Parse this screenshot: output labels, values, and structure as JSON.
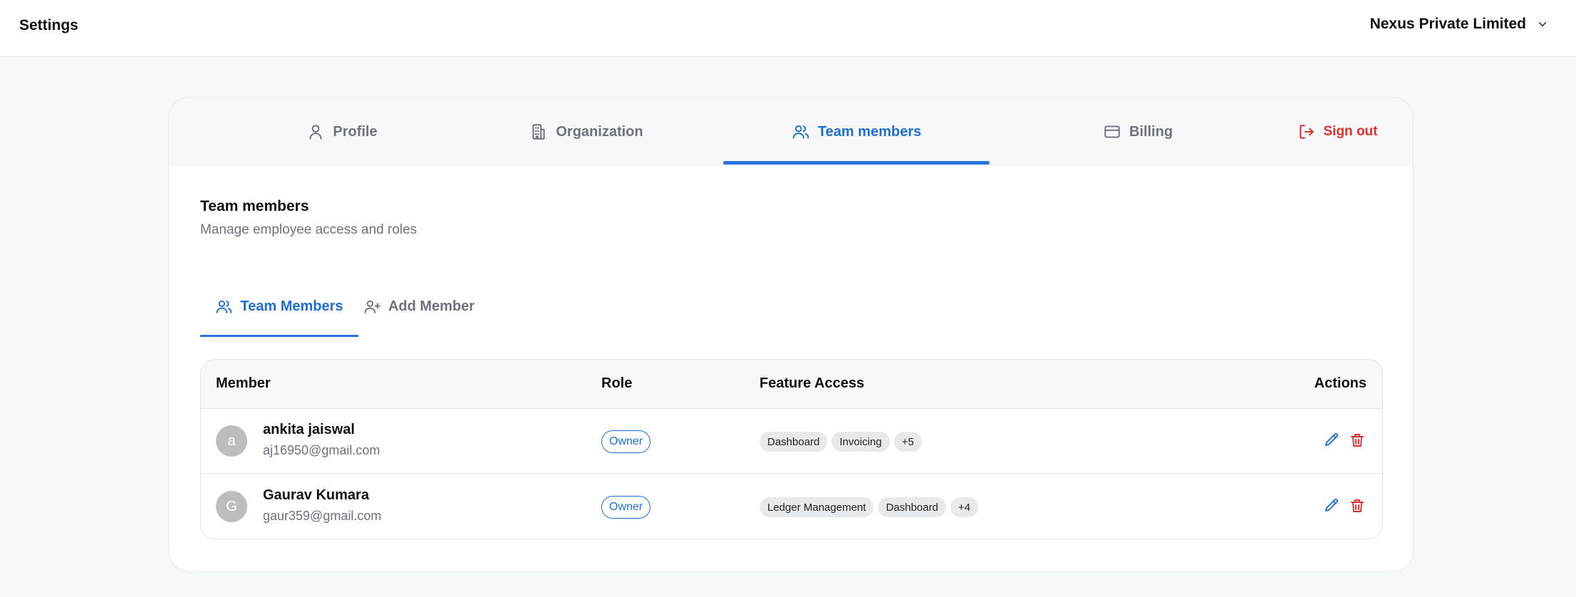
{
  "header": {
    "title": "Settings",
    "org_name": "Nexus Private Limited"
  },
  "tabs": [
    {
      "label": "Profile",
      "icon": "user-icon"
    },
    {
      "label": "Organization",
      "icon": "building-icon"
    },
    {
      "label": "Team members",
      "icon": "users-icon",
      "active": true
    },
    {
      "label": "Billing",
      "icon": "credit-card-icon"
    },
    {
      "label": "Sign out",
      "icon": "sign-out-icon"
    }
  ],
  "section": {
    "title": "Team members",
    "subtitle": "Manage employee access and roles"
  },
  "subtabs": [
    {
      "label": "Team Members",
      "icon": "users-icon",
      "active": true
    },
    {
      "label": "Add Member",
      "icon": "user-plus-icon"
    }
  ],
  "table": {
    "columns": [
      "Member",
      "Role",
      "Feature Access",
      "Actions"
    ],
    "rows": [
      {
        "initial": "a",
        "name": "ankita jaiswal",
        "email": "aj16950@gmail.com",
        "role": "Owner",
        "features": [
          "Dashboard",
          "Invoicing",
          "+5"
        ]
      },
      {
        "initial": "G",
        "name": "Gaurav Kumara",
        "email": "gaur359@gmail.com",
        "role": "Owner",
        "features": [
          "Ledger Management",
          "Dashboard",
          "+4"
        ]
      }
    ]
  },
  "colors": {
    "accent": "#1f6fd1",
    "danger": "#e0302b",
    "muted": "#6b7280"
  }
}
